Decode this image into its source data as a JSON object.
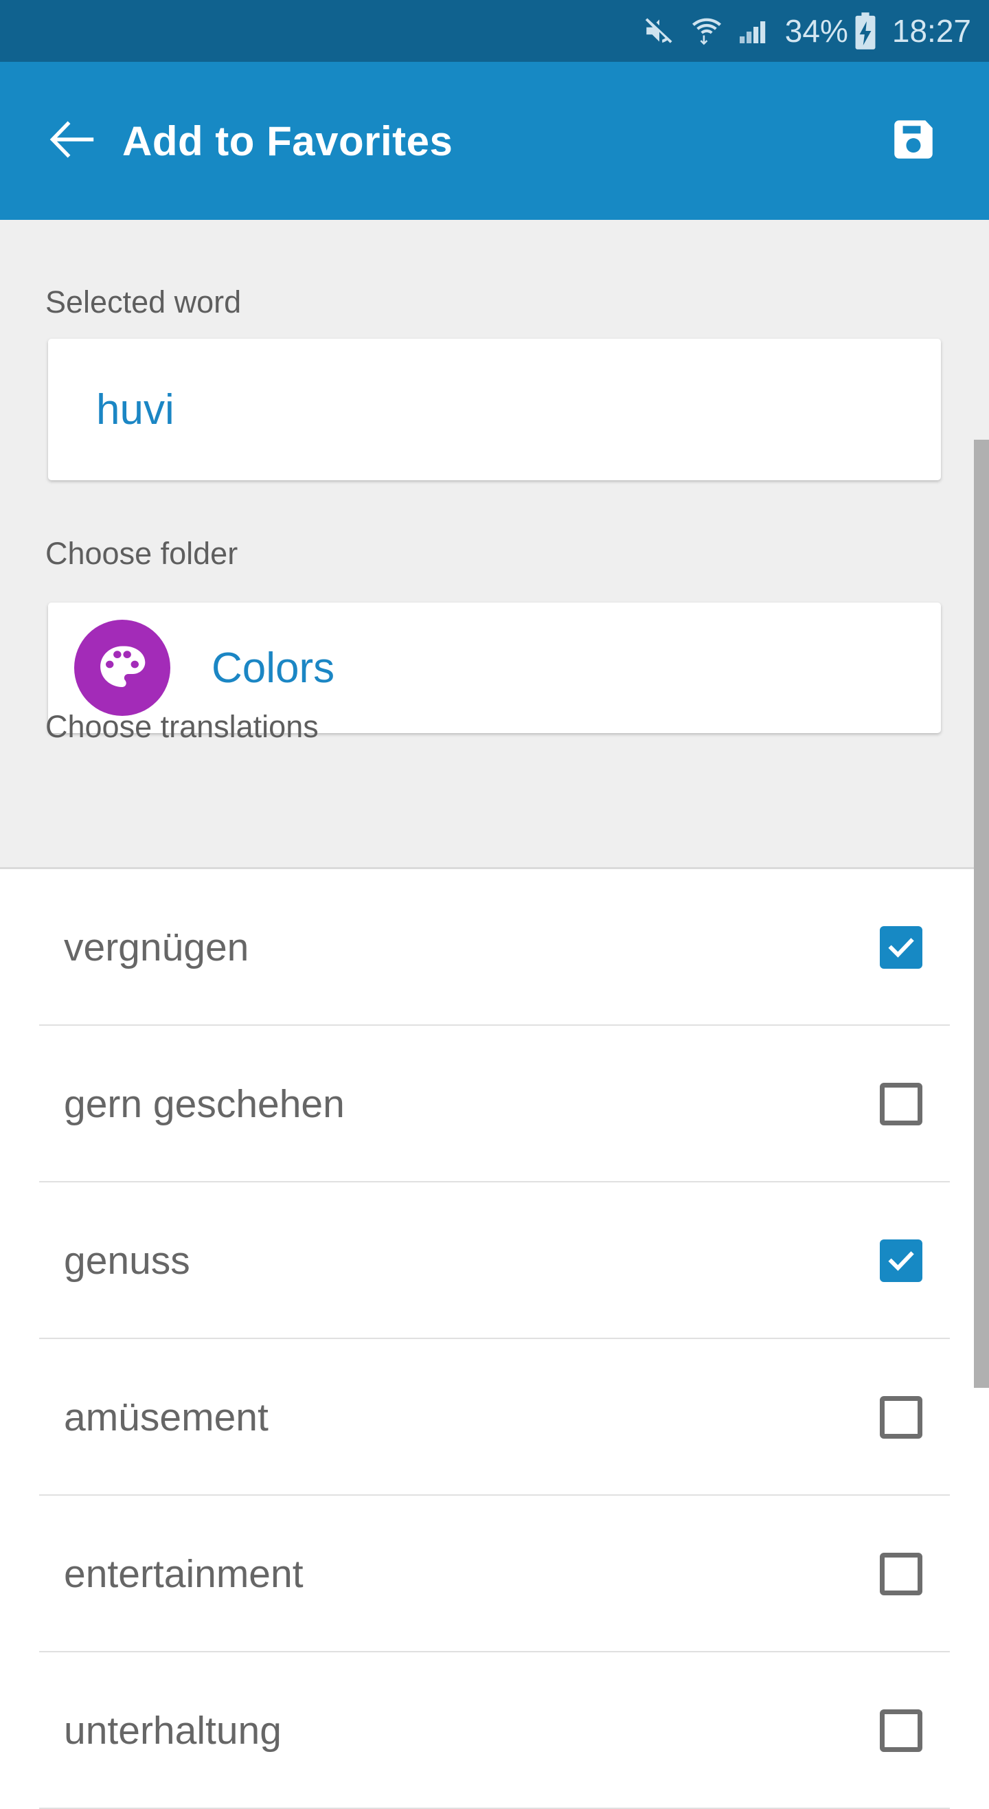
{
  "status_bar": {
    "mute_icon": "mute-icon",
    "wifi_icon": "wifi-transfer-icon",
    "signal_icon": "cellular-signal-icon",
    "battery_percent": "34%",
    "battery_icon": "battery-charging-icon",
    "clock": "18:27",
    "background_color": "#10628f",
    "text_color": "#d3e6f1"
  },
  "app_bar": {
    "back_icon": "back-arrow-icon",
    "title": "Add to Favorites",
    "save_icon": "save-floppy-icon",
    "background_color": "#1789c4",
    "text_color": "#ffffff"
  },
  "content": {
    "selected_word_label": "Selected word",
    "selected_word_value": "huvi",
    "choose_folder_label": "Choose folder",
    "folder_icon": "palette-icon",
    "folder_icon_color": "#a32bb8",
    "folder_name": "Colors",
    "choose_translations_label": "Choose translations",
    "background_color": "#efefef",
    "label_color": "#5e5e5e",
    "value_color": "#1b86c4"
  },
  "translations": [
    {
      "label": "vergnügen",
      "checked": true
    },
    {
      "label": "gern geschehen",
      "checked": false
    },
    {
      "label": "genuss",
      "checked": true
    },
    {
      "label": "amüsement",
      "checked": false
    },
    {
      "label": "entertainment",
      "checked": false
    },
    {
      "label": "unterhaltung",
      "checked": false
    }
  ],
  "checkbox": {
    "checked_color": "#1789c4",
    "unchecked_border_color": "#6e6e6e",
    "check_icon": "checkmark-icon"
  },
  "scrollbar": {
    "thumb_color": "#b0b0b0"
  }
}
